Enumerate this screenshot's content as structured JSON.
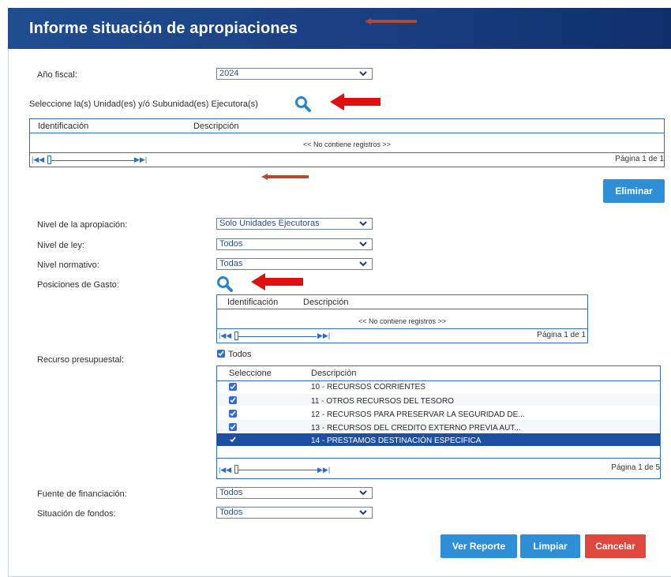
{
  "header": {
    "title": "Informe situación de apropiaciones"
  },
  "form": {
    "fiscal_year": {
      "label": "Año fiscal:",
      "value": "2024"
    },
    "units_label": "Seleccione la(s) Unidad(es) y/ó Subunidad(es) Ejecutora(s)",
    "units_grid": {
      "col_id": "Identificación",
      "col_desc": "Descripción",
      "empty": "<< No contiene registros >>",
      "page": "Página 1 de 1"
    },
    "delete_button": "Eliminar",
    "appropriation_level": {
      "label": "Nivel de la apropiación:",
      "value": "Solo Unidades Ejecutoras"
    },
    "law_level": {
      "label": "Nivel de ley:",
      "value": "Todos"
    },
    "normative_level": {
      "label": "Nivel normativo:",
      "value": "Todas"
    },
    "spending_positions": {
      "label": "Posiciones de Gasto:",
      "col_id": "Identificación",
      "col_desc": "Descripción",
      "empty": "<< No contiene registros >>",
      "page": "Página 1 de 1"
    },
    "budget_resource": {
      "label": "Recurso presupuestal:",
      "all_label": "Todos",
      "all_checked": true,
      "col_select": "Seleccione",
      "col_desc": "Descripción",
      "rows": [
        {
          "desc": "10 - RECURSOS CORRIENTES",
          "checked": true
        },
        {
          "desc": "11 - OTROS RECURSOS DEL TESORO",
          "checked": true
        },
        {
          "desc": "12 - RECURSOS PARA PRESERVAR LA SEGURIDAD DE...",
          "checked": true
        },
        {
          "desc": "13 - RECURSOS DEL CREDITO EXTERNO PREVIA AUT...",
          "checked": true
        },
        {
          "desc": "14 - PRESTAMOS DESTINACIÓN ESPECIFICA",
          "checked": true
        }
      ],
      "page": "Página 1 de 5"
    },
    "funding_source": {
      "label": "Fuente de financiación:",
      "value": "Todos"
    },
    "funds_status": {
      "label": "Situación de fondos:",
      "value": "Todos"
    }
  },
  "actions": {
    "view_report": "Ver Reporte",
    "clear": "Limpiar",
    "cancel": "Cancelar"
  },
  "colors": {
    "header": "#1f4d8f",
    "button_blue": "#2f8fd6",
    "button_red": "#e0473c",
    "annotation_arrow": "#e01010",
    "selected_row": "#1d4fa5"
  },
  "icons": [
    "search-icon",
    "chevron-down-icon",
    "first-page-icon",
    "prev-page-icon",
    "next-page-icon",
    "last-page-icon",
    "checkbox-icon",
    "annotation-arrow-icon"
  ]
}
